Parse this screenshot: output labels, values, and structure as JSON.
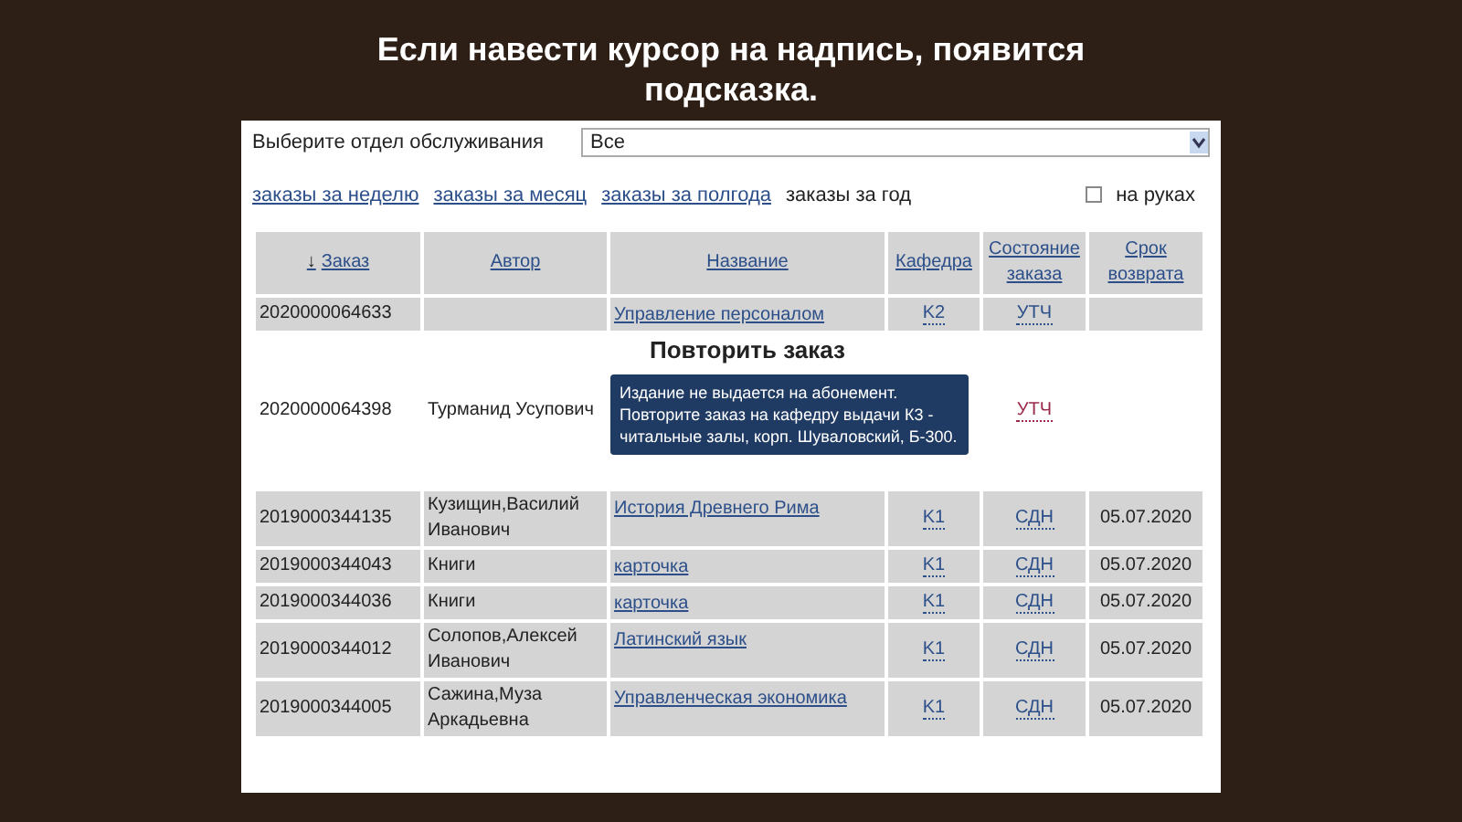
{
  "heading": "Если навести курсор на надпись,  появится подсказка.",
  "department": {
    "label": "Выберите отдел обслуживания",
    "value": "Все"
  },
  "periods": [
    {
      "label": "заказы за неделю",
      "selected": false
    },
    {
      "label": "заказы за месяц",
      "selected": false
    },
    {
      "label": "заказы за полгода",
      "selected": false
    },
    {
      "label": "заказы за год",
      "selected": true
    }
  ],
  "on_hand": {
    "label": "на руках",
    "checked": false
  },
  "table": {
    "sort_mark": "↓",
    "columns": [
      "Заказ",
      "Автор",
      "Название",
      "Кафедра",
      "Состояние заказа",
      "Срок возврата"
    ],
    "rows": [
      {
        "order": "2020000064633",
        "author": "",
        "title": "Управление персоналом",
        "dept": "K2",
        "status": "УТЧ",
        "due": "",
        "highlighted": false,
        "hovered": false
      },
      {
        "order": "2020000064398",
        "author": "Турманид Усупович",
        "title": "Повторить заказ",
        "dept": "",
        "status": "УТЧ",
        "due": "",
        "highlighted": true,
        "hovered": true
      },
      {
        "order": "2019000344135",
        "author": "Кузищин,Василий Иванович",
        "title": "История Древнего Рима",
        "dept": "K1",
        "status": "СДН",
        "due": "05.07.2020",
        "highlighted": false,
        "hovered": false
      },
      {
        "order": "2019000344043",
        "author": "Книги",
        "title": "карточка",
        "dept": "K1",
        "status": "СДН",
        "due": "05.07.2020",
        "highlighted": false,
        "hovered": false
      },
      {
        "order": "2019000344036",
        "author": "Книги",
        "title": "карточка",
        "dept": "K1",
        "status": "СДН",
        "due": "05.07.2020",
        "highlighted": false,
        "hovered": false
      },
      {
        "order": "2019000344012",
        "author": "Солопов,Алексей Иванович",
        "title": "Латинский язык",
        "dept": "K1",
        "status": "СДН",
        "due": "05.07.2020",
        "highlighted": false,
        "hovered": false
      },
      {
        "order": "2019000344005",
        "author": "Сажина,Муза Аркадьевна",
        "title": "Управленческая экономика",
        "dept": "K1",
        "status": "СДН",
        "due": "05.07.2020",
        "highlighted": false,
        "hovered": false
      }
    ]
  },
  "tooltip": "Издание не выдается на абонемент. Повторите заказ на кафедру выдачи К3 - читальные залы, корп. Шуваловский, Б-300."
}
